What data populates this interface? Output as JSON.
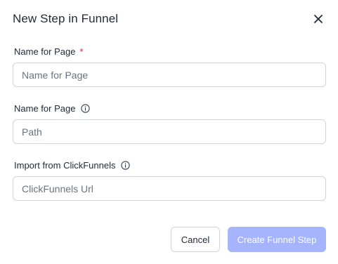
{
  "modal": {
    "title": "New Step in Funnel"
  },
  "fields": {
    "page_name": {
      "label": "Name for Page",
      "required_marker": "*",
      "placeholder": "Name for Page",
      "value": ""
    },
    "path": {
      "label": "Name for Page",
      "placeholder": "Path",
      "value": ""
    },
    "import": {
      "label": "Import from ClickFunnels",
      "placeholder": "ClickFunnels Url",
      "value": ""
    }
  },
  "buttons": {
    "cancel_label": "Cancel",
    "create_label": "Create Funnel Step"
  },
  "icons": {
    "close": "close-icon",
    "info": "info-circle-icon"
  },
  "colors": {
    "primary_disabled": "#a5b4fc",
    "required": "#dc2626",
    "text": "#1f2937"
  }
}
